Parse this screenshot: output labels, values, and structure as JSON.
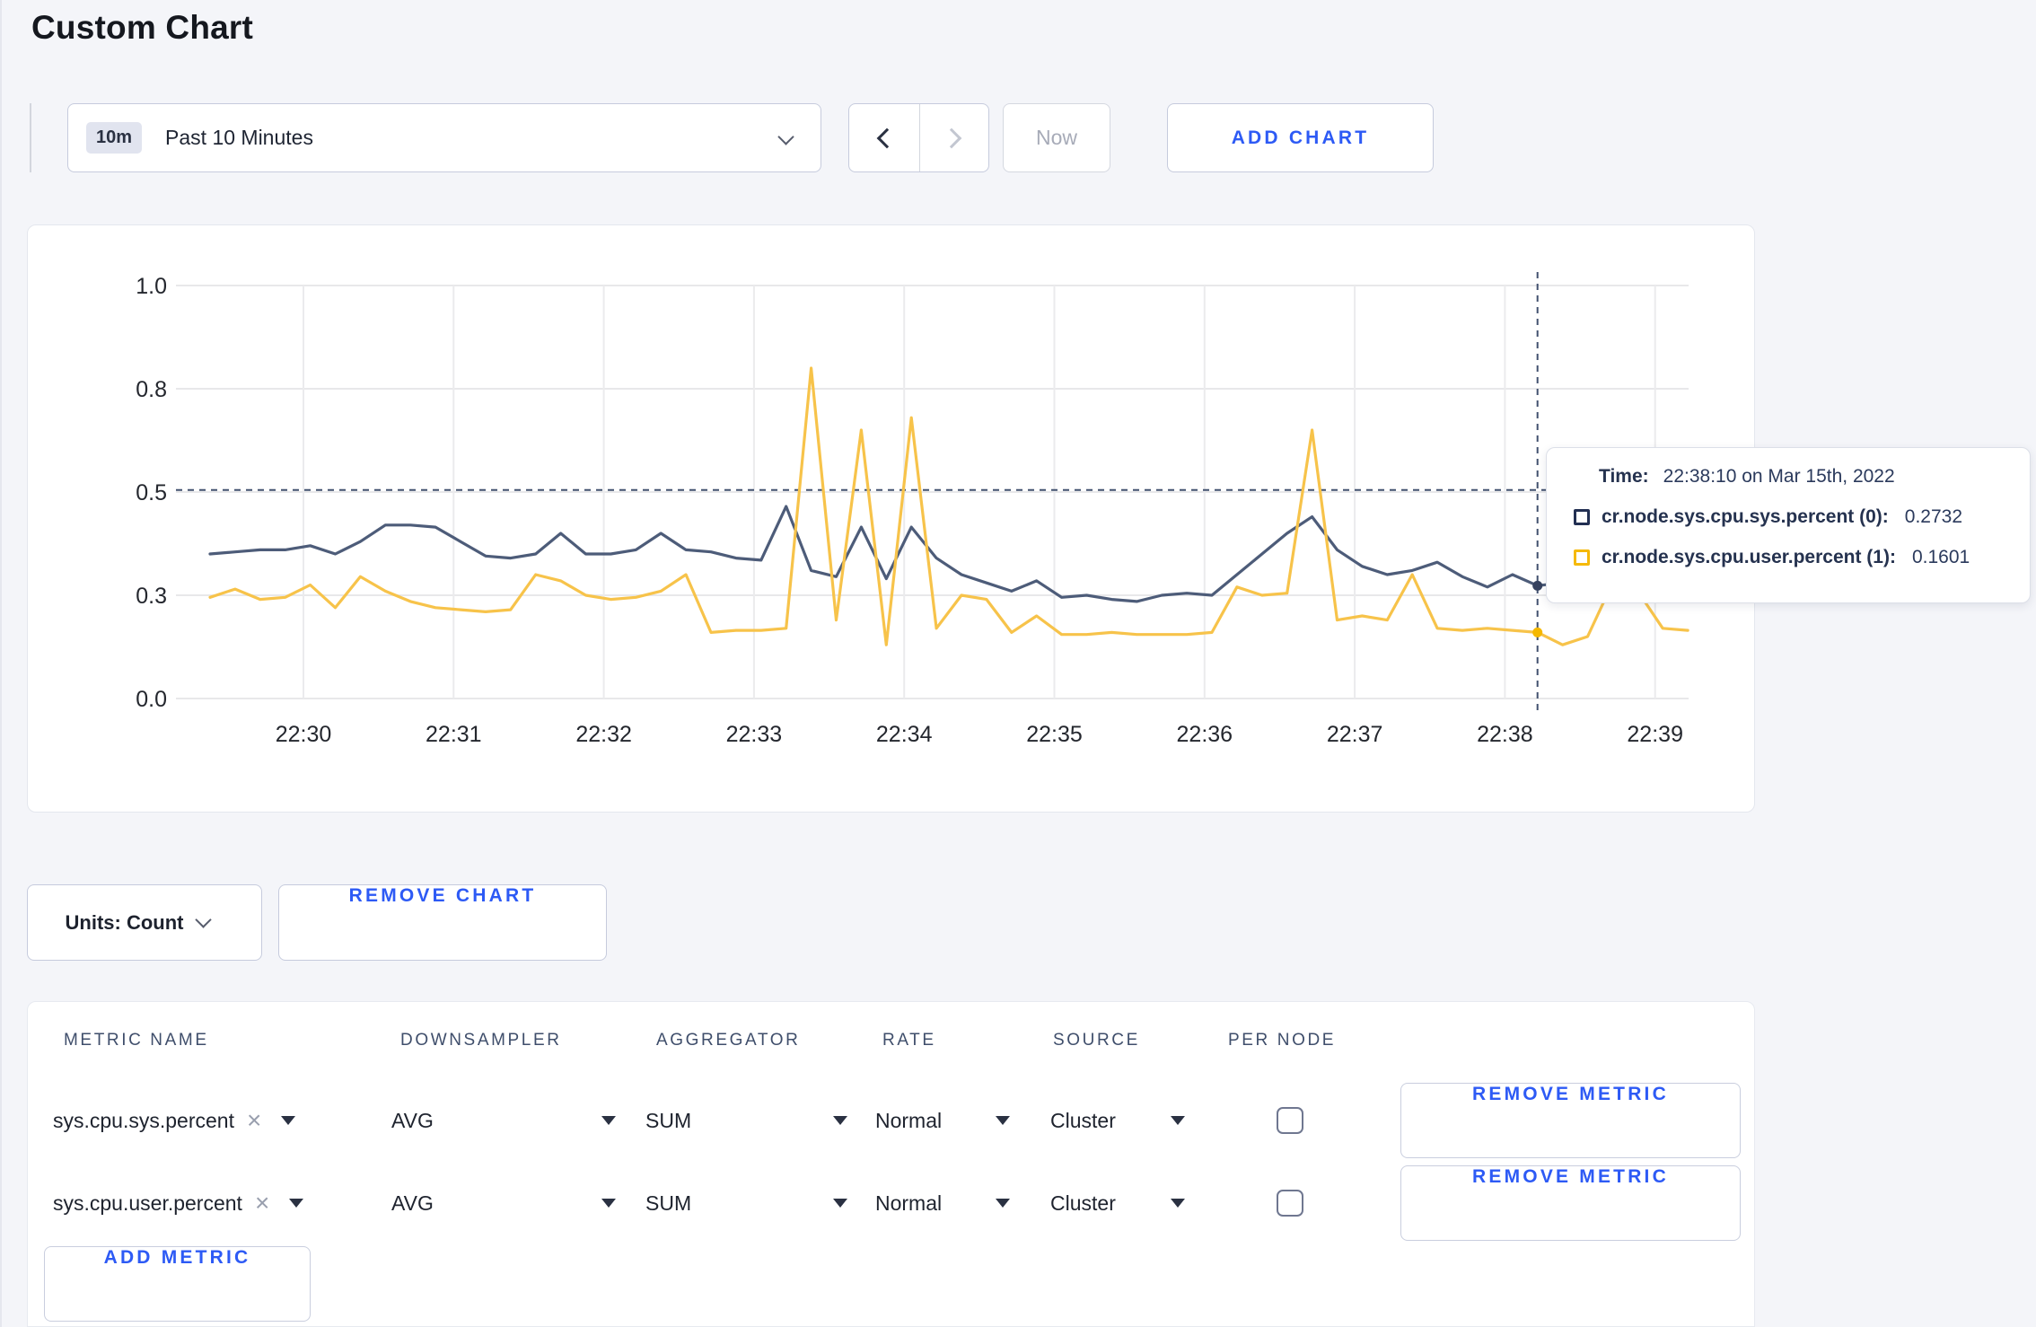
{
  "page_title": "Custom Chart",
  "toolbar": {
    "time_range_badge": "10m",
    "time_range_label": "Past 10 Minutes",
    "now_label": "Now",
    "add_chart_label": "ADD CHART"
  },
  "chart_controls": {
    "units_label": "Units: Count",
    "remove_chart_label": "REMOVE CHART"
  },
  "tooltip": {
    "time_label": "Time:",
    "time_value": "22:38:10 on Mar 15th, 2022",
    "rows": [
      {
        "label": "cr.node.sys.cpu.sys.percent (0):",
        "value": "0.2732",
        "color": "#222f52"
      },
      {
        "label": "cr.node.sys.cpu.user.percent (1):",
        "value": "0.1601",
        "color": "#f5b90a"
      }
    ]
  },
  "chart_data": {
    "type": "line",
    "title": "",
    "xlabel": "",
    "ylabel": "",
    "ylim": [
      0,
      1
    ],
    "grid": true,
    "x_start": "22:29:20",
    "x_interval_seconds": 10,
    "x_ticks": [
      "22:30",
      "22:31",
      "22:32",
      "22:33",
      "22:34",
      "22:35",
      "22:36",
      "22:37",
      "22:38",
      "22:39"
    ],
    "y_tick_labels": [
      "0.0",
      "0.3",
      "0.5",
      "0.8",
      "1.0"
    ],
    "y_tick_values": [
      0,
      0.25,
      0.5,
      0.75,
      1.0
    ],
    "series": [
      {
        "name": "cr.node.sys.cpu.sys.percent (0)",
        "color": "#4d5c79",
        "dot_color": "#36425f",
        "values": [
          0.35,
          0.355,
          0.36,
          0.36,
          0.37,
          0.35,
          0.38,
          0.42,
          0.42,
          0.415,
          0.38,
          0.345,
          0.34,
          0.35,
          0.4,
          0.35,
          0.35,
          0.36,
          0.4,
          0.36,
          0.355,
          0.34,
          0.335,
          0.465,
          0.31,
          0.295,
          0.415,
          0.29,
          0.415,
          0.34,
          0.3,
          0.28,
          0.26,
          0.285,
          0.245,
          0.25,
          0.24,
          0.235,
          0.25,
          0.255,
          0.25,
          0.3,
          0.35,
          0.4,
          0.44,
          0.36,
          0.32,
          0.3,
          0.31,
          0.33,
          0.295,
          0.27,
          0.3,
          0.2732,
          0.28,
          0.29,
          0.27,
          0.28,
          0.27,
          0.265
        ]
      },
      {
        "name": "cr.node.sys.cpu.user.percent (1)",
        "color": "#f7c34a",
        "dot_color": "#f5b800",
        "values": [
          0.245,
          0.265,
          0.24,
          0.245,
          0.275,
          0.22,
          0.295,
          0.26,
          0.235,
          0.22,
          0.215,
          0.21,
          0.215,
          0.3,
          0.285,
          0.25,
          0.24,
          0.245,
          0.26,
          0.3,
          0.16,
          0.165,
          0.165,
          0.17,
          0.8,
          0.19,
          0.65,
          0.13,
          0.68,
          0.17,
          0.25,
          0.24,
          0.16,
          0.2,
          0.155,
          0.155,
          0.16,
          0.155,
          0.155,
          0.155,
          0.16,
          0.27,
          0.25,
          0.255,
          0.65,
          0.19,
          0.2,
          0.19,
          0.3,
          0.17,
          0.165,
          0.17,
          0.165,
          0.1601,
          0.13,
          0.15,
          0.28,
          0.26,
          0.17,
          0.165
        ]
      }
    ],
    "crosshair": {
      "time": "22:38:10",
      "x_index": 53,
      "hline_value": 0.505,
      "points": [
        {
          "series": 0,
          "value": 0.2732
        },
        {
          "series": 1,
          "value": 0.1601
        }
      ]
    },
    "legend_position": "tooltip"
  },
  "metrics_table": {
    "columns": [
      "METRIC NAME",
      "DOWNSAMPLER",
      "AGGREGATOR",
      "RATE",
      "SOURCE",
      "PER NODE"
    ],
    "rows": [
      {
        "metric_name": "sys.cpu.sys.percent",
        "downsampler": "AVG",
        "aggregator": "SUM",
        "rate": "Normal",
        "source": "Cluster",
        "per_node_checked": false,
        "remove_label": "REMOVE METRIC"
      },
      {
        "metric_name": "sys.cpu.user.percent",
        "downsampler": "AVG",
        "aggregator": "SUM",
        "rate": "Normal",
        "source": "Cluster",
        "per_node_checked": false,
        "remove_label": "REMOVE METRIC"
      }
    ],
    "add_metric_label": "ADD METRIC"
  },
  "icons": {
    "remove_x": "×"
  },
  "colors": {
    "accent_blue": "#2d5af5",
    "series_sys": "#4d5c79",
    "series_user": "#f7c34a",
    "crosshair": "#41506e",
    "page_bg": "#f4f5f9"
  }
}
